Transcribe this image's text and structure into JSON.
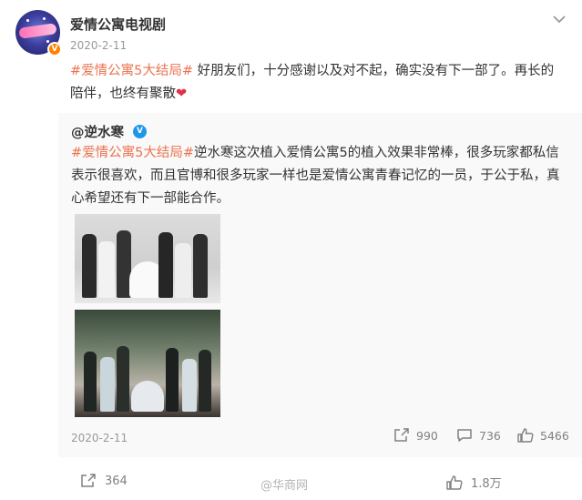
{
  "post": {
    "author": "爱情公寓电视剧",
    "time": "2020-2-11",
    "topic": "#爱情公寓5大结局#",
    "text": " 好朋友们，十分感谢以及对不起，确实没有下一部了。再长的陪伴，也终有聚散",
    "emoji": "❤"
  },
  "repost": {
    "author": "@逆水寒",
    "topic": "#爱情公寓5大结局#",
    "text": "逆水寒这次植入爱情公寓5的植入效果非常棒，很多玩家都私信表示很喜欢，而且官博和很多玩家一样也是爱情公寓青春记忆的一员，于公于私，真心希望还有下一部能合作。",
    "time": "2020-2-11",
    "forwards": "990",
    "comments": "736",
    "likes": "5466"
  },
  "actions": {
    "forwards": "364",
    "comments": "",
    "likes": "1.8万"
  },
  "watermark": "@华商网",
  "colors": {
    "topic": "#eb7350",
    "verified_orange": "#ff8200",
    "verified_blue": "#1f97e8",
    "muted": "#808080"
  },
  "icons": [
    "more-options-icon",
    "forward-icon",
    "comment-icon",
    "like-icon",
    "verified-icon"
  ]
}
